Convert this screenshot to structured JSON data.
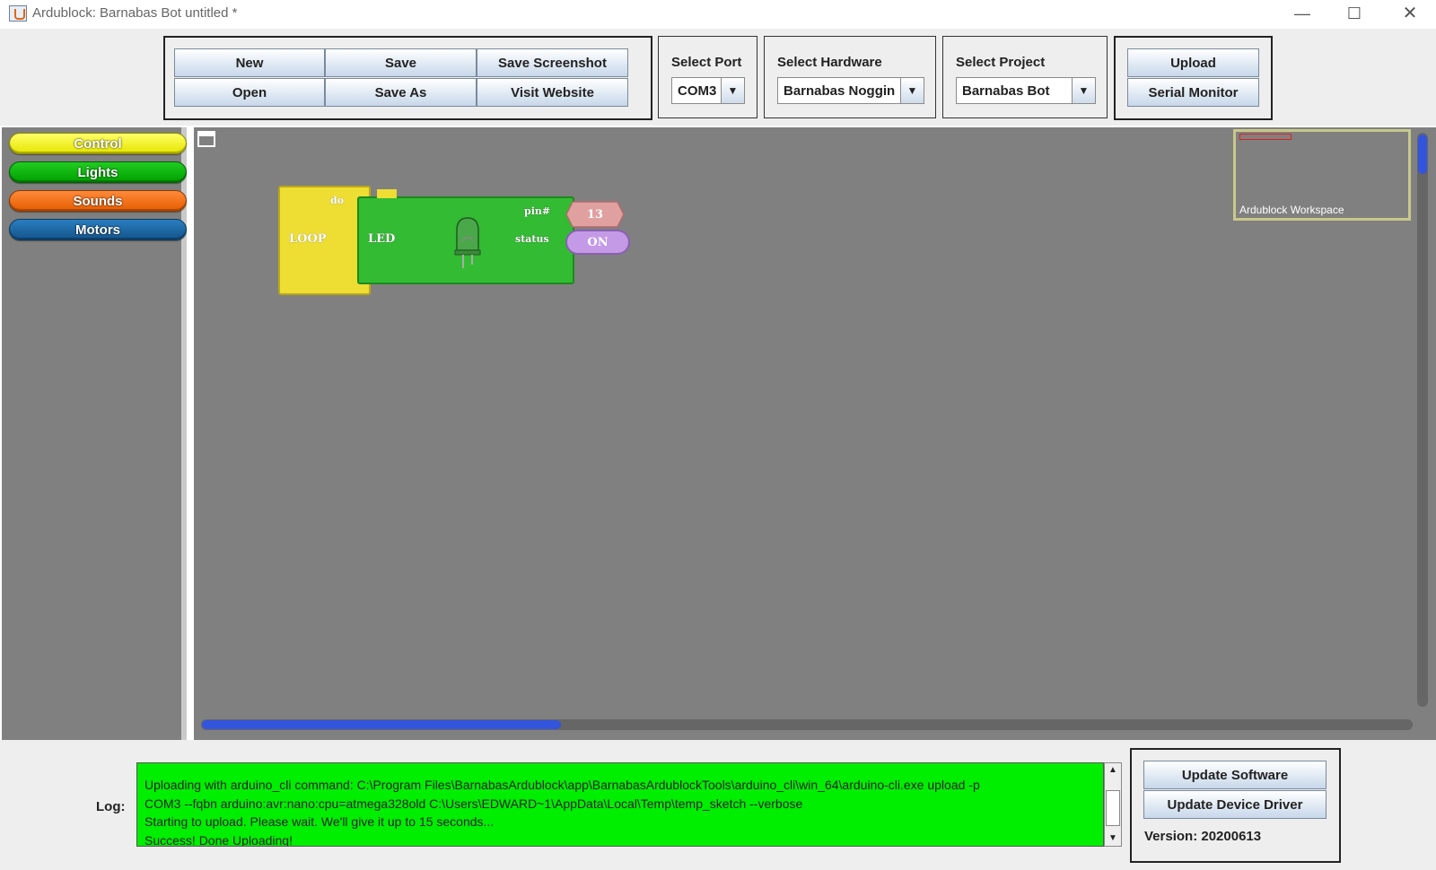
{
  "window": {
    "title": "Ardublock: Barnabas Bot untitled *",
    "minimize": "—",
    "maximize": "☐",
    "close": "✕"
  },
  "toolbar": {
    "file_buttons": {
      "new": "New",
      "save": "Save",
      "save_screenshot": "Save Screenshot",
      "open": "Open",
      "save_as": "Save As",
      "visit_website": "Visit Website"
    },
    "port": {
      "label": "Select Port",
      "value": "COM3"
    },
    "hardware": {
      "label": "Select Hardware",
      "value": "Barnabas Noggin"
    },
    "project": {
      "label": "Select Project",
      "value": "Barnabas Bot"
    },
    "upload": "Upload",
    "serial_monitor": "Serial Monitor"
  },
  "palette": {
    "categories": [
      "Control",
      "Lights",
      "Sounds",
      "Motors"
    ]
  },
  "workspace": {
    "minimap_label": "Ardublock Workspace",
    "blocks": {
      "loop": {
        "do_label": "do",
        "name": "LOOP"
      },
      "led": {
        "name": "LED",
        "pin_label": "pin#",
        "status_label": "status"
      },
      "pin_value": "13",
      "status_value": "ON"
    }
  },
  "log": {
    "label": "Log:",
    "lines": [
      "Uploading with arduino_cli command: C:\\Program Files\\BarnabasArdublock\\app\\BarnabasArdublockTools\\arduino_cli\\win_64\\arduino-cli.exe upload -p",
      "COM3 --fqbn arduino:avr:nano:cpu=atmega328old C:\\Users\\EDWARD~1\\AppData\\Local\\Temp\\temp_sketch --verbose",
      "Starting to upload. Please wait.  We'll give it up to 15 seconds...",
      "Success! Done Uploading!"
    ],
    "background_color": "#00ee00"
  },
  "updates": {
    "update_software": "Update Software",
    "update_device_driver": "Update Device Driver",
    "version": "Version: 20200613"
  },
  "colors": {
    "control": "#eedd33",
    "lights": "#00a000",
    "sounds": "#e65d00",
    "motors": "#14548a",
    "scroll_thumb": "#3355dd"
  }
}
